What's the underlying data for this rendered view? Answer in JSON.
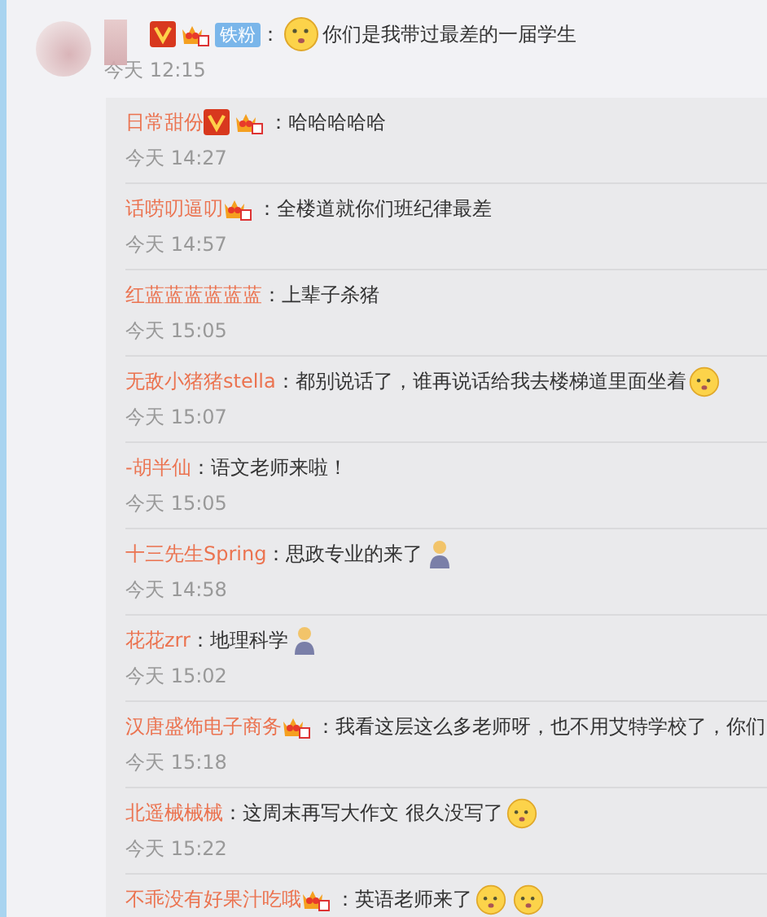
{
  "comment": {
    "badges": [
      {
        "kind": "verified"
      },
      {
        "kind": "vip"
      },
      {
        "kind": "fan",
        "label": "铁粉"
      }
    ],
    "separator": "：",
    "lead_emojis": [
      {
        "kind": "face"
      }
    ],
    "text": "你们是我带过最差的一届学生",
    "time": "今天 12:15"
  },
  "replies": [
    {
      "name": "日常甜份",
      "badges": [
        {
          "kind": "verified"
        },
        {
          "kind": "vip"
        }
      ],
      "text": "：哈哈哈哈哈",
      "time": "今天 14:27"
    },
    {
      "name": "话唠叨逼叨",
      "badges": [
        {
          "kind": "vip"
        }
      ],
      "text": "：全楼道就你们班纪律最差",
      "time": "今天 14:57"
    },
    {
      "name": "红蓝蓝蓝蓝蓝蓝",
      "text": "：上辈子杀猪",
      "time": "今天 15:05"
    },
    {
      "name": "无敌小猪猪stella",
      "text": "：都别说话了，谁再说话给我去楼梯道里面坐着",
      "emojis": [
        {
          "kind": "face"
        }
      ],
      "time": "今天 15:07"
    },
    {
      "name": "-胡半仙",
      "text": "：语文老师来啦！",
      "time": "今天 15:05"
    },
    {
      "name": "十三先生Spring",
      "text": "：思政专业的来了",
      "emojis": [
        {
          "kind": "person"
        }
      ],
      "time": "今天 14:58"
    },
    {
      "name": "花花zrr",
      "text": "：地理科学",
      "emojis": [
        {
          "kind": "person"
        }
      ],
      "time": "今天 15:02"
    },
    {
      "name": "汉唐盛饰电子商务",
      "badges": [
        {
          "kind": "vip"
        }
      ],
      "text": "：我看这层这么多老师呀，也不用艾特学校了，你们",
      "time": "今天 15:18"
    },
    {
      "name": "北遥械械械",
      "text": "：这周末再写大作文  很久没写了",
      "emojis": [
        {
          "kind": "face"
        }
      ],
      "time": "今天 15:22"
    },
    {
      "name": "不乖没有好果汁吃哦",
      "badges": [
        {
          "kind": "vip"
        }
      ],
      "text": "：英语老师来了",
      "emojis": [
        {
          "kind": "face"
        },
        {
          "kind": "face"
        }
      ]
    }
  ]
}
